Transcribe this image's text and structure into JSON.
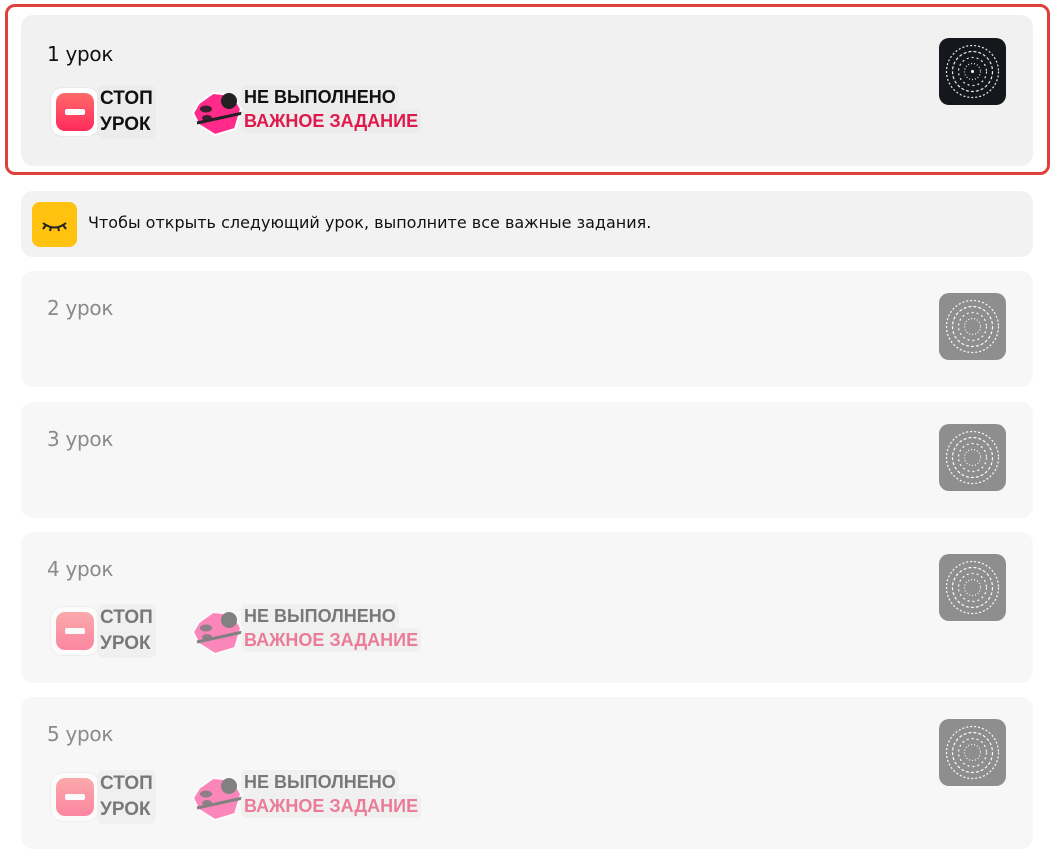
{
  "lessons": [
    {
      "title": "1 урок",
      "status": "active",
      "stop_line1": "СТОП",
      "stop_line2": "УРОК",
      "task_line1": "НЕ ВЫПОЛНЕНО",
      "task_line2": "ВАЖНОЕ ЗАДАНИЕ"
    },
    {
      "title": "2 урок",
      "status": "locked"
    },
    {
      "title": "3 урок",
      "status": "locked"
    },
    {
      "title": "4 урок",
      "status": "locked",
      "stop_line1": "СТОП",
      "stop_line2": "УРОК",
      "task_line1": "НЕ ВЫПОЛНЕНО",
      "task_line2": "ВАЖНОЕ ЗАДАНИЕ"
    },
    {
      "title": "5 урок",
      "status": "locked",
      "stop_line1": "СТОП",
      "stop_line2": "УРОК",
      "task_line1": "НЕ ВЫПОЛНЕНО",
      "task_line2": "ВАЖНОЕ ЗАДАНИЕ"
    }
  ],
  "notice": {
    "text": "Чтобы открыть следующий урок, выполните все важные задания.",
    "icon": "closed-eye-icon"
  },
  "colors": {
    "highlight": "#e0403a",
    "accent_pink": "#e0194d",
    "notice_yellow": "#ffc20e"
  },
  "icons": {
    "stop": "stop-sign-icon",
    "task": "important-task-icon",
    "thumb": "mandala-thumbnail"
  }
}
